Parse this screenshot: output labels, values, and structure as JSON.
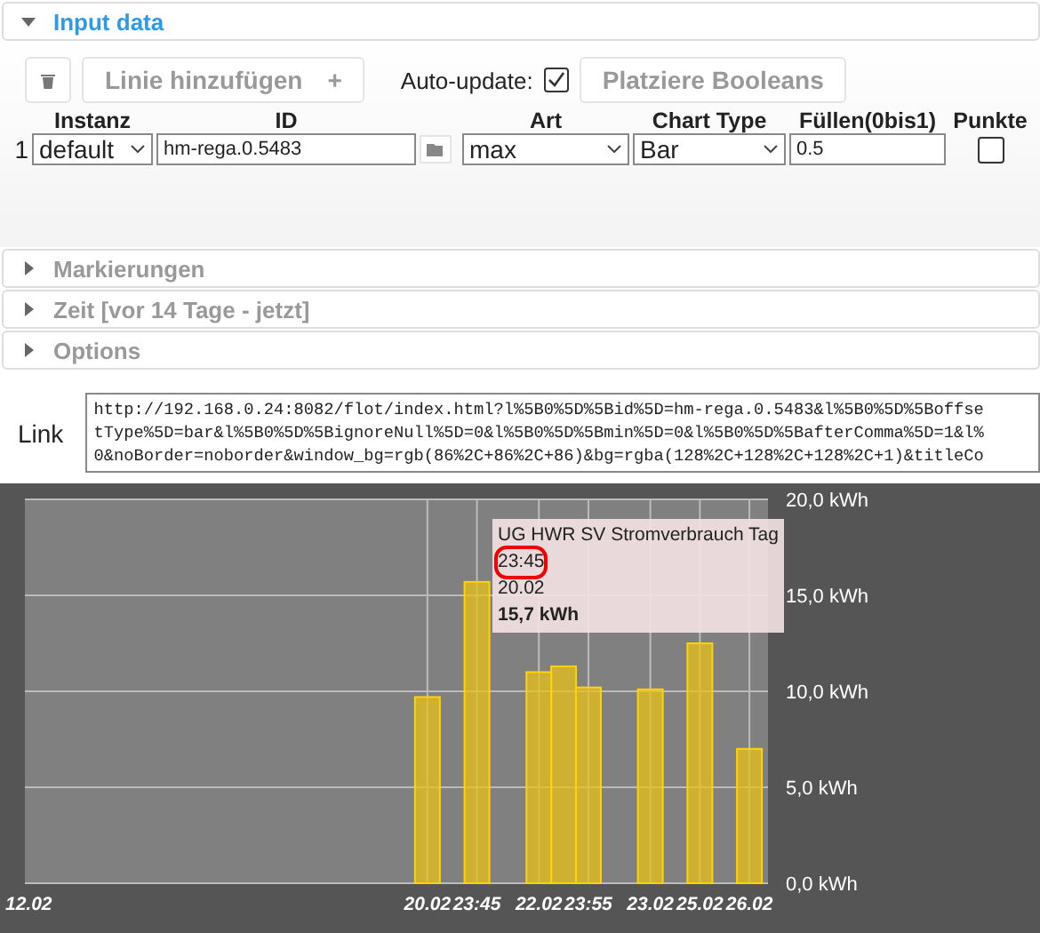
{
  "input_data": {
    "title": "Input data",
    "expanded": true,
    "toolbar": {
      "add_button": "Linie hinzufügen",
      "add_icon": "+",
      "auto_update_label": "Auto-update:",
      "auto_update_checked": true,
      "booleans_button": "Platziere Booleans"
    },
    "columns": [
      "Instanz",
      "ID",
      "Art",
      "Chart Type",
      "Füllen(0bis1)",
      "Punkte"
    ],
    "rows": [
      {
        "index": "1",
        "instance": "default",
        "id": "hm-rega.0.5483",
        "art": "max",
        "chart_type": "Bar",
        "fill": "0.5",
        "points_checked": false
      }
    ]
  },
  "sections": [
    {
      "title": "Markierungen",
      "expanded": false
    },
    {
      "title": "Zeit [vor 14 Tage - jetzt]",
      "expanded": false
    },
    {
      "title": "Options",
      "expanded": false
    }
  ],
  "link": {
    "label": "Link",
    "lines": [
      "http://192.168.0.24:8082/flot/index.html?l%5B0%5D%5Bid%5D=hm-rega.0.5483&l%5B0%5D%5Boffse",
      "tType%5D=bar&l%5B0%5D%5BignoreNull%5D=0&l%5B0%5D%5Bmin%5D=0&l%5B0%5D%5BafterComma%5D=1&l%",
      "0&noBorder=noborder&window_bg=rgb(86%2C+86%2C+86)&bg=rgba(128%2C+128%2C+128%2C+1)&titleCo"
    ]
  },
  "chart": {
    "chart_data": {
      "type": "bar",
      "grid": true,
      "ylim": [
        0,
        20
      ],
      "categories": [
        "12.02",
        null,
        null,
        null,
        null,
        null,
        null,
        null,
        null,
        null,
        null,
        null,
        null,
        null,
        null,
        null,
        null,
        null,
        null,
        null,
        null,
        null,
        null,
        null,
        null,
        null,
        null,
        null,
        null,
        null,
        null,
        null,
        "20.02",
        null,
        null,
        null,
        "23:45",
        null,
        null,
        null,
        null,
        "22.02",
        null,
        null,
        null,
        "23:55",
        null,
        null,
        null,
        null,
        "23.02",
        null,
        null,
        null,
        "25.02",
        null,
        null,
        null,
        "26.02",
        null
      ],
      "series": [
        {
          "name": "UG HWR SV Stromverbrauch Tag",
          "color": "#e8c21a",
          "values": [
            null,
            null,
            null,
            null,
            null,
            null,
            null,
            null,
            null,
            null,
            null,
            null,
            null,
            null,
            null,
            null,
            null,
            null,
            null,
            null,
            null,
            null,
            null,
            null,
            null,
            null,
            null,
            null,
            null,
            null,
            null,
            null,
            9.7,
            null,
            null,
            null,
            15.7,
            null,
            null,
            null,
            null,
            11.0,
            null,
            11.3,
            null,
            10.2,
            null,
            null,
            null,
            null,
            10.1,
            null,
            null,
            null,
            12.5,
            null,
            null,
            null,
            7.0,
            null
          ]
        }
      ],
      "yticks": [
        {
          "value": 0,
          "label": "0,0 kWh"
        },
        {
          "value": 5,
          "label": "5,0 kWh"
        },
        {
          "value": 10,
          "label": "10,0 kWh"
        },
        {
          "value": 15,
          "label": "15,0 kWh"
        },
        {
          "value": 20,
          "label": "20,0 kWh"
        }
      ]
    },
    "tooltip": {
      "lines": [
        {
          "text": "23:45",
          "highlighted": true,
          "bold": false
        },
        {
          "text": "20.02",
          "highlighted": false,
          "bold": false
        },
        {
          "text": "15,7 kWh",
          "highlighted": false,
          "bold": true
        }
      ]
    }
  }
}
